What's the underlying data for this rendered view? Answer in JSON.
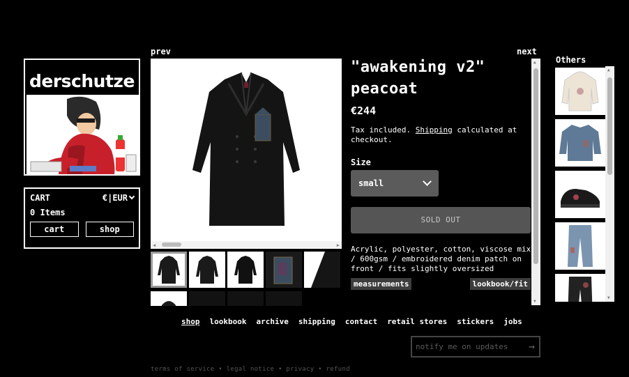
{
  "brand": {
    "name": "derschutze"
  },
  "cart": {
    "title": "CART",
    "currency": "€|EUR",
    "count_label": "0 Items",
    "cart_button": "cart",
    "shop_button": "shop"
  },
  "nav": {
    "prev": "prev",
    "next": "next"
  },
  "product": {
    "title": "\"awakening v2\" peacoat",
    "price": "€244",
    "tax_pre": "Tax included. ",
    "tax_link": "Shipping",
    "tax_post": " calculated at checkout.",
    "size_label": "Size",
    "size_value": "small",
    "sold_out": "SOLD OUT",
    "description": "Acrylic, polyester, cotton, viscose mix / 600gsm / embroidered denim patch on front / fits slightly oversized",
    "measurements": "measurements",
    "lookbook_fit": "lookbook/fit"
  },
  "others": {
    "label": "Others"
  },
  "footer": {
    "links": [
      "shop",
      "lookbook",
      "archive",
      "shipping",
      "contact",
      "retail stores",
      "stickers",
      "jobs"
    ],
    "notify_placeholder": "notify me on updates",
    "legal": "terms of service • legal notice • privacy • refund"
  }
}
